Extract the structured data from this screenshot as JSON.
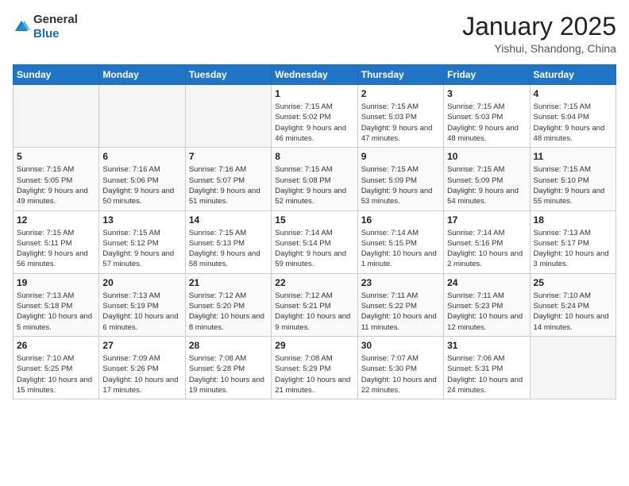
{
  "logo": {
    "general": "General",
    "blue": "Blue"
  },
  "header": {
    "month": "January 2025",
    "location": "Yishui, Shandong, China"
  },
  "weekdays": [
    "Sunday",
    "Monday",
    "Tuesday",
    "Wednesday",
    "Thursday",
    "Friday",
    "Saturday"
  ],
  "weeks": [
    [
      {
        "day": "",
        "sunrise": "",
        "sunset": "",
        "daylight": ""
      },
      {
        "day": "",
        "sunrise": "",
        "sunset": "",
        "daylight": ""
      },
      {
        "day": "",
        "sunrise": "",
        "sunset": "",
        "daylight": ""
      },
      {
        "day": "1",
        "sunrise": "Sunrise: 7:15 AM",
        "sunset": "Sunset: 5:02 PM",
        "daylight": "Daylight: 9 hours and 46 minutes."
      },
      {
        "day": "2",
        "sunrise": "Sunrise: 7:15 AM",
        "sunset": "Sunset: 5:03 PM",
        "daylight": "Daylight: 9 hours and 47 minutes."
      },
      {
        "day": "3",
        "sunrise": "Sunrise: 7:15 AM",
        "sunset": "Sunset: 5:03 PM",
        "daylight": "Daylight: 9 hours and 48 minutes."
      },
      {
        "day": "4",
        "sunrise": "Sunrise: 7:15 AM",
        "sunset": "Sunset: 5:04 PM",
        "daylight": "Daylight: 9 hours and 48 minutes."
      }
    ],
    [
      {
        "day": "5",
        "sunrise": "Sunrise: 7:15 AM",
        "sunset": "Sunset: 5:05 PM",
        "daylight": "Daylight: 9 hours and 49 minutes."
      },
      {
        "day": "6",
        "sunrise": "Sunrise: 7:16 AM",
        "sunset": "Sunset: 5:06 PM",
        "daylight": "Daylight: 9 hours and 50 minutes."
      },
      {
        "day": "7",
        "sunrise": "Sunrise: 7:16 AM",
        "sunset": "Sunset: 5:07 PM",
        "daylight": "Daylight: 9 hours and 51 minutes."
      },
      {
        "day": "8",
        "sunrise": "Sunrise: 7:15 AM",
        "sunset": "Sunset: 5:08 PM",
        "daylight": "Daylight: 9 hours and 52 minutes."
      },
      {
        "day": "9",
        "sunrise": "Sunrise: 7:15 AM",
        "sunset": "Sunset: 5:09 PM",
        "daylight": "Daylight: 9 hours and 53 minutes."
      },
      {
        "day": "10",
        "sunrise": "Sunrise: 7:15 AM",
        "sunset": "Sunset: 5:09 PM",
        "daylight": "Daylight: 9 hours and 54 minutes."
      },
      {
        "day": "11",
        "sunrise": "Sunrise: 7:15 AM",
        "sunset": "Sunset: 5:10 PM",
        "daylight": "Daylight: 9 hours and 55 minutes."
      }
    ],
    [
      {
        "day": "12",
        "sunrise": "Sunrise: 7:15 AM",
        "sunset": "Sunset: 5:11 PM",
        "daylight": "Daylight: 9 hours and 56 minutes."
      },
      {
        "day": "13",
        "sunrise": "Sunrise: 7:15 AM",
        "sunset": "Sunset: 5:12 PM",
        "daylight": "Daylight: 9 hours and 57 minutes."
      },
      {
        "day": "14",
        "sunrise": "Sunrise: 7:15 AM",
        "sunset": "Sunset: 5:13 PM",
        "daylight": "Daylight: 9 hours and 58 minutes."
      },
      {
        "day": "15",
        "sunrise": "Sunrise: 7:14 AM",
        "sunset": "Sunset: 5:14 PM",
        "daylight": "Daylight: 9 hours and 59 minutes."
      },
      {
        "day": "16",
        "sunrise": "Sunrise: 7:14 AM",
        "sunset": "Sunset: 5:15 PM",
        "daylight": "Daylight: 10 hours and 1 minute."
      },
      {
        "day": "17",
        "sunrise": "Sunrise: 7:14 AM",
        "sunset": "Sunset: 5:16 PM",
        "daylight": "Daylight: 10 hours and 2 minutes."
      },
      {
        "day": "18",
        "sunrise": "Sunrise: 7:13 AM",
        "sunset": "Sunset: 5:17 PM",
        "daylight": "Daylight: 10 hours and 3 minutes."
      }
    ],
    [
      {
        "day": "19",
        "sunrise": "Sunrise: 7:13 AM",
        "sunset": "Sunset: 5:18 PM",
        "daylight": "Daylight: 10 hours and 5 minutes."
      },
      {
        "day": "20",
        "sunrise": "Sunrise: 7:13 AM",
        "sunset": "Sunset: 5:19 PM",
        "daylight": "Daylight: 10 hours and 6 minutes."
      },
      {
        "day": "21",
        "sunrise": "Sunrise: 7:12 AM",
        "sunset": "Sunset: 5:20 PM",
        "daylight": "Daylight: 10 hours and 8 minutes."
      },
      {
        "day": "22",
        "sunrise": "Sunrise: 7:12 AM",
        "sunset": "Sunset: 5:21 PM",
        "daylight": "Daylight: 10 hours and 9 minutes."
      },
      {
        "day": "23",
        "sunrise": "Sunrise: 7:11 AM",
        "sunset": "Sunset: 5:22 PM",
        "daylight": "Daylight: 10 hours and 11 minutes."
      },
      {
        "day": "24",
        "sunrise": "Sunrise: 7:11 AM",
        "sunset": "Sunset: 5:23 PM",
        "daylight": "Daylight: 10 hours and 12 minutes."
      },
      {
        "day": "25",
        "sunrise": "Sunrise: 7:10 AM",
        "sunset": "Sunset: 5:24 PM",
        "daylight": "Daylight: 10 hours and 14 minutes."
      }
    ],
    [
      {
        "day": "26",
        "sunrise": "Sunrise: 7:10 AM",
        "sunset": "Sunset: 5:25 PM",
        "daylight": "Daylight: 10 hours and 15 minutes."
      },
      {
        "day": "27",
        "sunrise": "Sunrise: 7:09 AM",
        "sunset": "Sunset: 5:26 PM",
        "daylight": "Daylight: 10 hours and 17 minutes."
      },
      {
        "day": "28",
        "sunrise": "Sunrise: 7:08 AM",
        "sunset": "Sunset: 5:28 PM",
        "daylight": "Daylight: 10 hours and 19 minutes."
      },
      {
        "day": "29",
        "sunrise": "Sunrise: 7:08 AM",
        "sunset": "Sunset: 5:29 PM",
        "daylight": "Daylight: 10 hours and 21 minutes."
      },
      {
        "day": "30",
        "sunrise": "Sunrise: 7:07 AM",
        "sunset": "Sunset: 5:30 PM",
        "daylight": "Daylight: 10 hours and 22 minutes."
      },
      {
        "day": "31",
        "sunrise": "Sunrise: 7:06 AM",
        "sunset": "Sunset: 5:31 PM",
        "daylight": "Daylight: 10 hours and 24 minutes."
      },
      {
        "day": "",
        "sunrise": "",
        "sunset": "",
        "daylight": ""
      }
    ]
  ]
}
